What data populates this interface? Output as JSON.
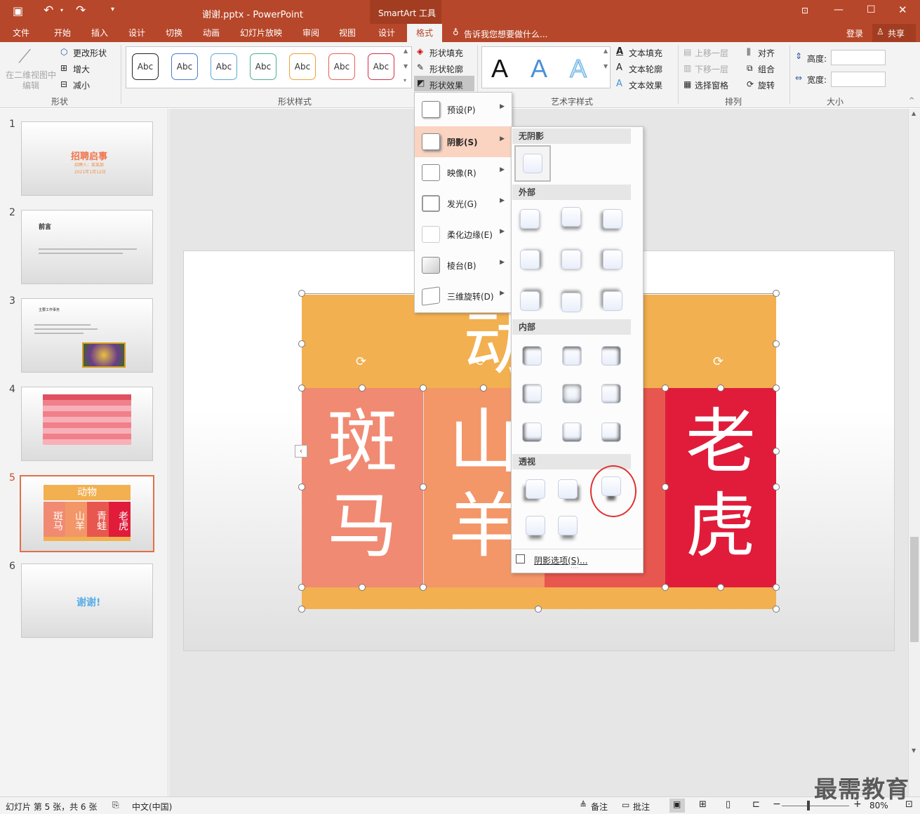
{
  "window": {
    "title": "谢谢.pptx - PowerPoint",
    "context_tool": "SmartArt 工具"
  },
  "tabs": [
    {
      "label": "文件"
    },
    {
      "label": "开始"
    },
    {
      "label": "插入"
    },
    {
      "label": "设计"
    },
    {
      "label": "切换"
    },
    {
      "label": "动画"
    },
    {
      "label": "幻灯片放映"
    },
    {
      "label": "审阅"
    },
    {
      "label": "视图"
    },
    {
      "label": "设计"
    },
    {
      "label": "格式"
    }
  ],
  "tell_me": "告诉我您想要做什么...",
  "account": {
    "login": "登录",
    "share": "共享"
  },
  "ribbon": {
    "shape_group": {
      "label": "形状",
      "edit_in_2d": "在二维视图中编辑",
      "change_shape": "更改形状",
      "larger": "增大",
      "smaller": "减小"
    },
    "shape_styles": {
      "label": "形状样式",
      "sample": "Abc",
      "fill": "形状填充",
      "outline": "形状轮廓",
      "effects": "形状效果"
    },
    "wordart": {
      "label": "艺术字样式",
      "sample": "A",
      "text_fill": "文本填充",
      "text_outline": "文本轮廓",
      "text_effects": "文本效果"
    },
    "arrange": {
      "label": "排列",
      "bring_forward": "上移一层",
      "send_backward": "下移一层",
      "selection_pane": "选择窗格",
      "align": "对齐",
      "group": "组合",
      "rotate": "旋转"
    },
    "size": {
      "label": "大小",
      "height": "高度:",
      "width": "宽度:"
    }
  },
  "slides": [
    {
      "num": "1",
      "title": "招聘启事",
      "sub1": "招聘人：某某部",
      "sub2": "2021年1月12日"
    },
    {
      "num": "2",
      "title": "前言"
    },
    {
      "num": "3",
      "title": "主要工作事务"
    },
    {
      "num": "4"
    },
    {
      "num": "5",
      "title": "动物",
      "cells": [
        "斑马",
        "山羊",
        "青蛙",
        "老虎"
      ]
    },
    {
      "num": "6",
      "title": "谢谢!"
    }
  ],
  "smartart": {
    "header": "动",
    "cells": [
      {
        "top": "斑",
        "bottom": "马",
        "color": "#f08a72"
      },
      {
        "top": "山",
        "bottom": "羊",
        "color": "#f39668"
      },
      {
        "top": "",
        "bottom": "",
        "color": "#e8574f"
      },
      {
        "top": "老",
        "bottom": "虎",
        "color": "#e01c3a"
      }
    ],
    "header_color": "#f2b050"
  },
  "effects_menu": [
    {
      "label": "预设(P)"
    },
    {
      "label": "阴影(S)"
    },
    {
      "label": "映像(R)"
    },
    {
      "label": "发光(G)"
    },
    {
      "label": "柔化边缘(E)"
    },
    {
      "label": "棱台(B)"
    },
    {
      "label": "三维旋转(D)"
    }
  ],
  "shadow_panel": {
    "no_shadow": "无阴影",
    "outer": "外部",
    "inner": "内部",
    "perspective": "透视",
    "options": "阴影选项(S)..."
  },
  "status": {
    "slide_info": "幻灯片 第 5 张，共 6 张",
    "language": "中文(中国)",
    "notes": "备注",
    "comments": "批注",
    "zoom": "80%"
  },
  "watermark": "最需教育"
}
